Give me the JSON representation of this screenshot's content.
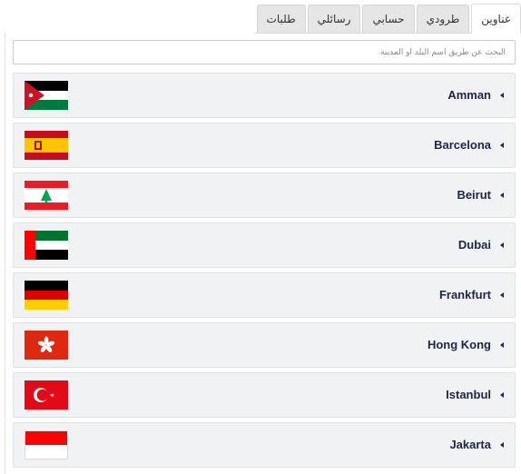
{
  "tabs": [
    {
      "label": "عناوين",
      "active": true
    },
    {
      "label": "طرودي",
      "active": false
    },
    {
      "label": "حسابي",
      "active": false
    },
    {
      "label": "رسائلي",
      "active": false
    },
    {
      "label": "طلبات",
      "active": false
    }
  ],
  "search": {
    "placeholder": "البحث عن طريق اسم البلد أو المدينة"
  },
  "cities": [
    {
      "name": "Amman",
      "flag": "jordan-flag-icon"
    },
    {
      "name": "Barcelona",
      "flag": "spain-flag-icon"
    },
    {
      "name": "Beirut",
      "flag": "lebanon-flag-icon"
    },
    {
      "name": "Dubai",
      "flag": "uae-flag-icon"
    },
    {
      "name": "Frankfurt",
      "flag": "germany-flag-icon"
    },
    {
      "name": "Hong Kong",
      "flag": "hong-kong-flag-icon"
    },
    {
      "name": "Istanbul",
      "flag": "turkey-flag-icon"
    },
    {
      "name": "Jakarta",
      "flag": "indonesia-flag-icon"
    }
  ],
  "colors": {
    "accent_text": "#1f2544",
    "row_bg": "#f1f2f4",
    "tab_bg": "#e6e6e6"
  }
}
